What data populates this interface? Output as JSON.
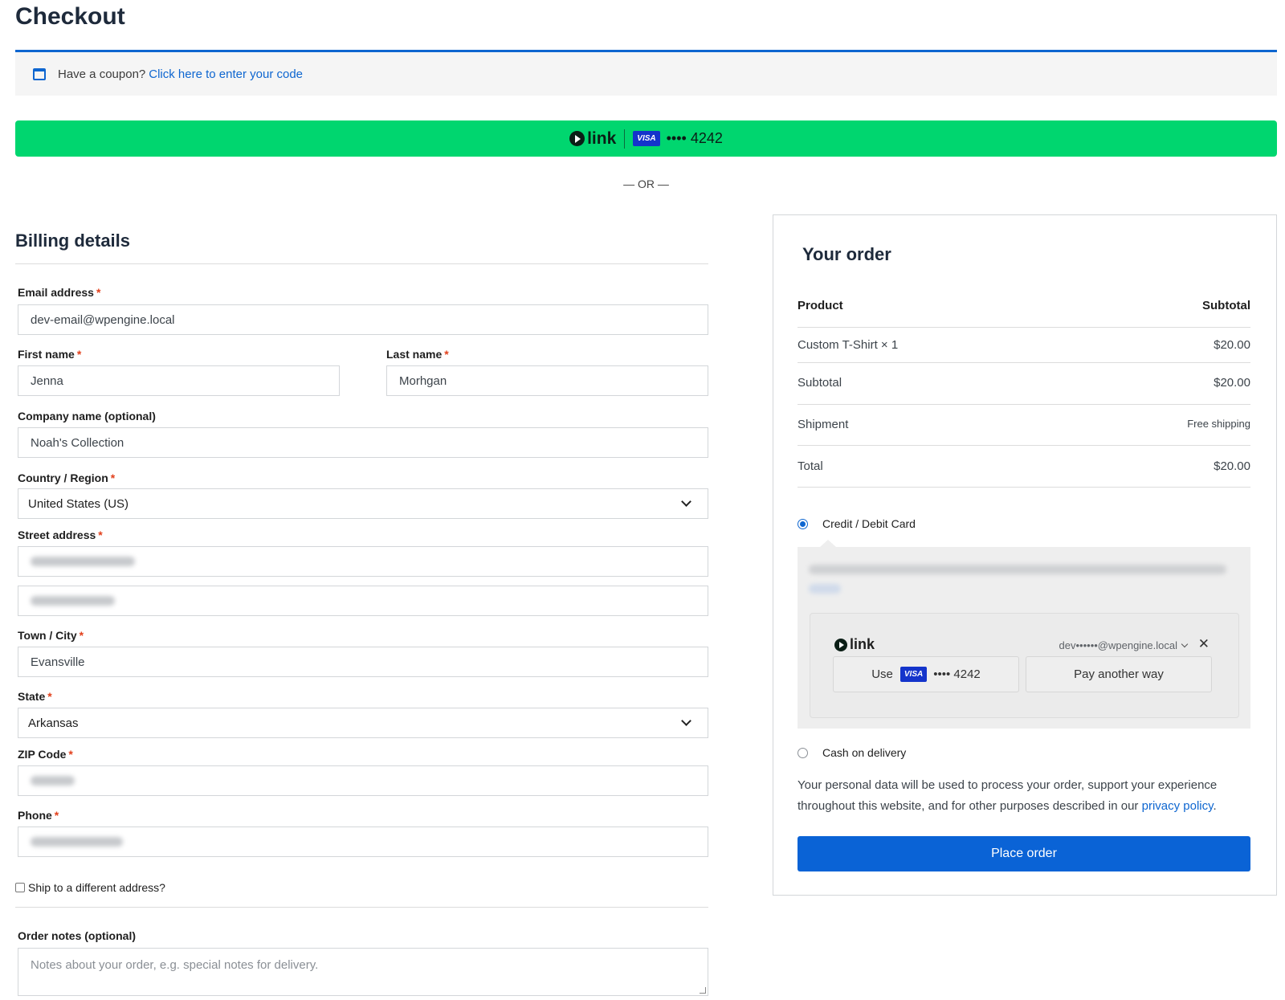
{
  "page": {
    "title": "Checkout"
  },
  "coupon": {
    "prompt": "Have a coupon?",
    "link": "Click here to enter your code"
  },
  "express": {
    "brand": "link",
    "card_brand": "VISA",
    "card_masked": "•••• 4242"
  },
  "or_text": "— OR —",
  "billing": {
    "title": "Billing details",
    "email": {
      "label": "Email address",
      "value": "dev-email@wpengine.local"
    },
    "first_name": {
      "label": "First name",
      "value": "Jenna"
    },
    "last_name": {
      "label": "Last name",
      "value": "Morhgan"
    },
    "company": {
      "label": "Company name (optional)",
      "value": "Noah's Collection"
    },
    "country": {
      "label": "Country / Region",
      "value": "United States (US)"
    },
    "street": {
      "label": "Street address"
    },
    "city": {
      "label": "Town / City",
      "value": "Evansville"
    },
    "state": {
      "label": "State",
      "value": "Arkansas"
    },
    "zip": {
      "label": "ZIP Code"
    },
    "phone": {
      "label": "Phone"
    },
    "required_mark": "*",
    "ship_different": "Ship to a different address?",
    "notes": {
      "label": "Order notes (optional)",
      "placeholder": "Notes about your order, e.g. special notes for delivery."
    }
  },
  "order": {
    "title": "Your order",
    "head": {
      "product": "Product",
      "subtotal": "Subtotal"
    },
    "rows": [
      {
        "label": "Custom T-Shirt × 1",
        "value": "$20.00"
      },
      {
        "label": "Subtotal",
        "value": "$20.00"
      },
      {
        "label": "Shipment",
        "value": "Free shipping"
      },
      {
        "label": "Total",
        "value": "$20.00"
      }
    ],
    "payment": {
      "card_label": "Credit / Debit Card",
      "link_brand": "link",
      "link_email": "dev••••••@wpengine.local",
      "close": "✕",
      "use_label": "Use",
      "card_brand": "VISA",
      "card_masked": "•••• 4242",
      "another_way": "Pay another way",
      "cod_label": "Cash on delivery"
    },
    "privacy_text": "Your personal data will be used to process your order, support your experience throughout this website, and for other purposes described in our",
    "privacy_link": "privacy policy",
    "privacy_end": ".",
    "place_order": "Place order"
  }
}
